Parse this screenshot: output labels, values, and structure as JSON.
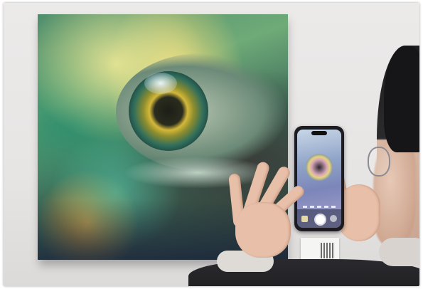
{
  "scene": {
    "description_text": "",
    "colors": {
      "wall": "#e9e7e6",
      "painting_green": "#4f8e6c",
      "painting_gold": "#d4b83a",
      "phone_body": "#1c1c22",
      "coat": "#1d1d20"
    }
  },
  "icons": {
    "shutter": "shutter-button-icon",
    "gallery": "gallery-thumbnail-icon",
    "flip": "camera-flip-icon",
    "qr": "qr-code-icon"
  }
}
